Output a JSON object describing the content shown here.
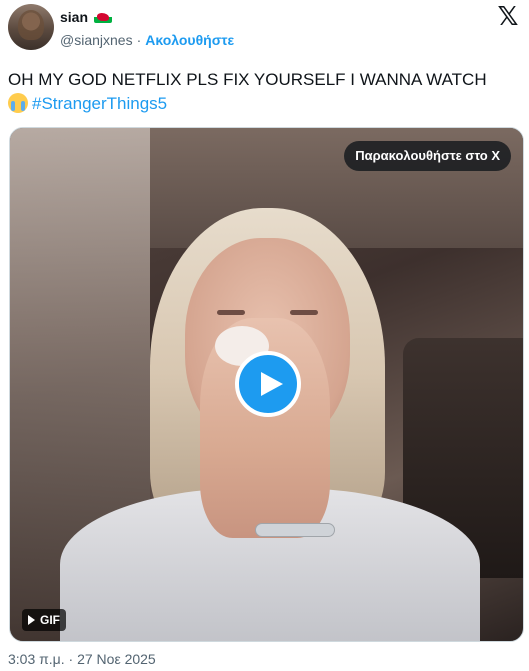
{
  "header": {
    "display_name": "sian",
    "flag_icon": "wales-flag-icon",
    "handle": "@sianjxnes",
    "separator": "·",
    "follow_label": "Ακολουθήστε",
    "logo_icon": "x-logo-icon",
    "logo_glyph": "𝕏"
  },
  "tweet": {
    "text": "OH MY GOD NETFLIX PLS FIX YOURSELF I WANNA WATCH",
    "emoji_icon": "loudly-crying-face-icon",
    "hashtag": "#StrangerThings5"
  },
  "media": {
    "watch_label": "Παρακολουθήστε στο X",
    "play_icon": "play-icon",
    "badge_label": "GIF",
    "colors": {
      "play": "#1d9bf0"
    }
  },
  "footer": {
    "timestamp": "3:03 π.μ. · 27 Νοε 2025"
  },
  "colors": {
    "accent": "#1d9bf0",
    "text": "#0f1419",
    "muted": "#536471"
  }
}
